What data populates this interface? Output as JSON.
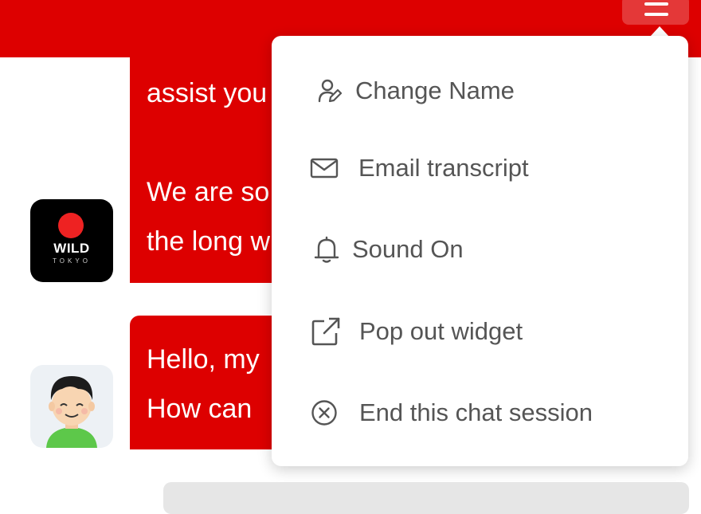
{
  "colors": {
    "brand": "#dd0000",
    "menu_text": "#555555"
  },
  "header": {
    "menu_button_icon": "hamburger-icon"
  },
  "messages": [
    {
      "sender": "bot",
      "avatar_text": "WILD",
      "avatar_subtext": "TOKYO",
      "lines": [
        "assist you",
        "",
        "We are so",
        "the long w"
      ]
    },
    {
      "sender": "agent",
      "lines": [
        "Hello, my",
        "How can"
      ]
    }
  ],
  "menu": {
    "items": [
      {
        "label": "Change Name",
        "icon": "user-edit-icon"
      },
      {
        "label": "Email transcript",
        "icon": "envelope-icon"
      },
      {
        "label": "Sound On",
        "icon": "bell-icon"
      },
      {
        "label": "Pop out widget",
        "icon": "external-link-icon"
      },
      {
        "label": "End this chat session",
        "icon": "close-circle-icon"
      }
    ]
  }
}
